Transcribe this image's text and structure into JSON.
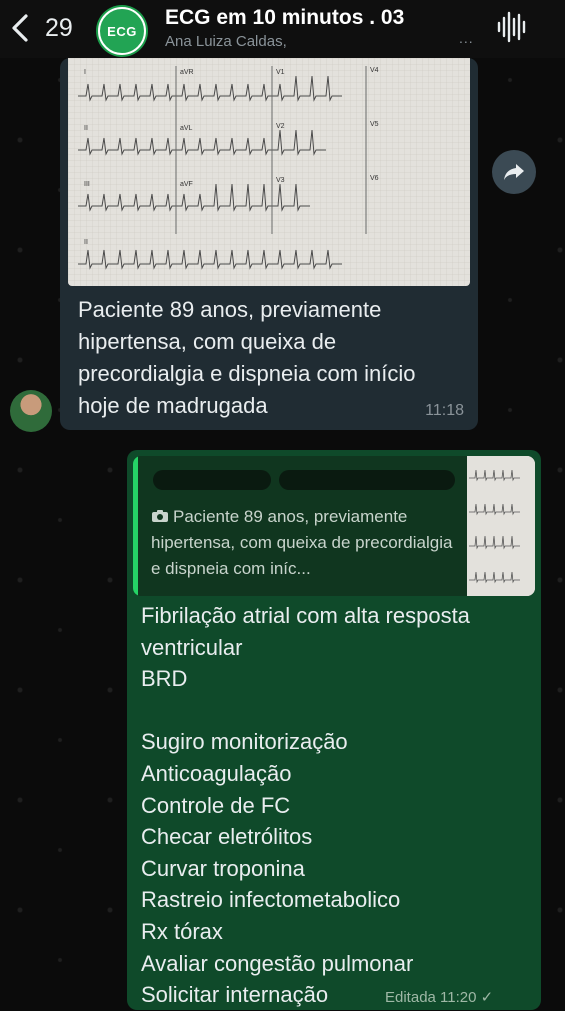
{
  "header": {
    "back_count": "29",
    "group_logo": "ECG",
    "title": "ECG em 10 minutos . 03",
    "subtitle": "Ana Luiza Caldas,",
    "more": "...",
    "icons": {
      "back": "chevron-left-icon",
      "voice": "audio-wave-icon"
    }
  },
  "incoming": {
    "image_alt": "ECG 12 derivações",
    "lead_labels": [
      "I",
      "aVR",
      "V1",
      "V4",
      "II",
      "aVL",
      "V2",
      "V5",
      "III",
      "aVF",
      "V3",
      "V6",
      "II"
    ],
    "text": "Paciente 89 anos, previamente hipertensa, com queixa de precordialgia e dispneia com início hoje de madrugada",
    "time": "11:18",
    "forward_icon": "forward-icon"
  },
  "outgoing": {
    "quote_text": "Paciente 89 anos, previamente hipertensa, com queixa de precordialgia e dispneia com iníc...",
    "quote_icon": "camera-icon",
    "lines": [
      "Fibrilação atrial com alta resposta",
      "ventricular",
      "BRD",
      "",
      "Sugiro monitorização",
      "Anticoagulação",
      "Controle de FC",
      "Checar eletrólitos",
      "Curvar troponina",
      "Rastreio infectometabolico",
      "Rx tórax",
      "Avaliar congestão pulmonar",
      "Solicitar internação"
    ],
    "edited_label": "Editada 11:20 ✓"
  },
  "colors": {
    "background": "#0b0b0b",
    "incoming_bubble": "#202c33",
    "outgoing_bubble": "#0f4a2a",
    "accent": "#25d366"
  }
}
